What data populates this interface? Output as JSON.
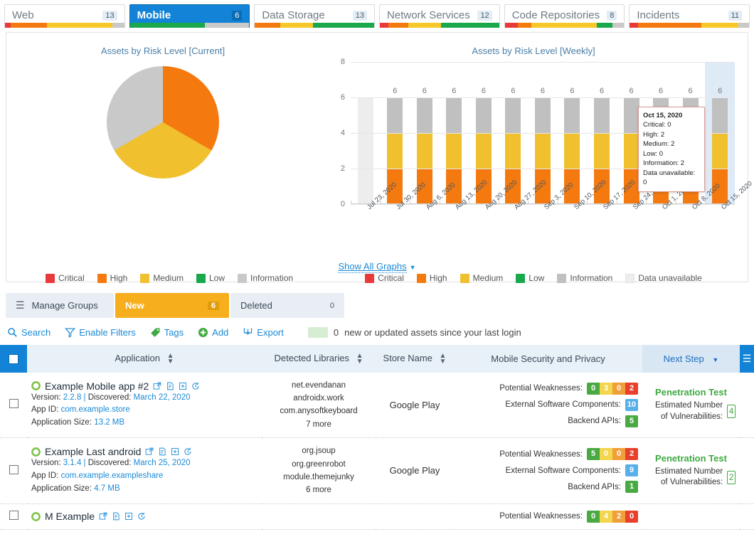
{
  "tabs": [
    {
      "label": "Web",
      "count": "13",
      "active": false,
      "bar": [
        {
          "color": "#e8393b",
          "w": 5
        },
        {
          "color": "#f47a10",
          "w": 30
        },
        {
          "color": "#f6c82a",
          "w": 55
        },
        {
          "color": "#c9c9c9",
          "w": 10
        }
      ]
    },
    {
      "label": "Mobile",
      "count": "6",
      "active": true,
      "bar": [
        {
          "color": "#1aa84c",
          "w": 63
        },
        {
          "color": "#c9c9c9",
          "w": 37
        }
      ]
    },
    {
      "label": "Data Storage",
      "count": "13",
      "active": false,
      "bar": [
        {
          "color": "#f47a10",
          "w": 21
        },
        {
          "color": "#f6c82a",
          "w": 28
        },
        {
          "color": "#1aa84c",
          "w": 51
        }
      ]
    },
    {
      "label": "Network Services",
      "count": "12",
      "active": false,
      "bar": [
        {
          "color": "#e8393b",
          "w": 7
        },
        {
          "color": "#f47a10",
          "w": 17
        },
        {
          "color": "#f6c82a",
          "w": 27
        },
        {
          "color": "#1aa84c",
          "w": 49
        }
      ]
    },
    {
      "label": "Code Repositories",
      "count": "8",
      "active": false,
      "bar": [
        {
          "color": "#e8393b",
          "w": 11
        },
        {
          "color": "#f47a10",
          "w": 11
        },
        {
          "color": "#f6c82a",
          "w": 55
        },
        {
          "color": "#1aa84c",
          "w": 13
        },
        {
          "color": "#c9c9c9",
          "w": 10
        }
      ]
    },
    {
      "label": "Incidents",
      "count": "11",
      "active": false,
      "bar": [
        {
          "color": "#e8393b",
          "w": 7
        },
        {
          "color": "#f47a10",
          "w": 53
        },
        {
          "color": "#f6c82a",
          "w": 31
        },
        {
          "color": "#c9c9c9",
          "w": 9
        }
      ]
    }
  ],
  "chart_data": [
    {
      "type": "pie",
      "title": "Assets by Risk Level [Current]",
      "categories": [
        "Critical",
        "High",
        "Medium",
        "Low",
        "Information"
      ],
      "values": [
        0,
        2,
        2,
        0,
        2
      ],
      "colors": [
        "#e8393b",
        "#f47a10",
        "#f0c02e",
        "#1aa84c",
        "#c9c9c9"
      ],
      "legend_position": "bottom"
    },
    {
      "type": "bar",
      "title": "Assets by Risk Level [Weekly]",
      "stacked": true,
      "grid": true,
      "ylim": [
        0,
        8
      ],
      "yticks": [
        "0",
        "2",
        "4",
        "6",
        "8"
      ],
      "legend_position": "bottom",
      "categories": [
        "Jul 23, 2020",
        "Jul 30, 2020",
        "Aug 6, 2020",
        "Aug 13, 2020",
        "Aug 20, 2020",
        "Aug 27, 2020",
        "Sep 3, 2020",
        "Sep 10, 2020",
        "Sep 17, 2020",
        "Sep 24, 2020",
        "Oct 1, 2020",
        "Oct 8, 2020",
        "Oct 15, 2020"
      ],
      "totals": [
        "",
        "6",
        "6",
        "6",
        "6",
        "6",
        "6",
        "6",
        "6",
        "6",
        "6",
        "6",
        "6"
      ],
      "series": [
        {
          "name": "Critical",
          "color": "#e8393b",
          "values": [
            0,
            0,
            0,
            0,
            0,
            0,
            0,
            0,
            0,
            0,
            0,
            0,
            0
          ]
        },
        {
          "name": "High",
          "color": "#f47a10",
          "values": [
            0,
            2,
            2,
            2,
            2,
            2,
            2,
            2,
            2,
            2,
            2,
            2,
            2
          ]
        },
        {
          "name": "Medium",
          "color": "#f0c02e",
          "values": [
            0,
            2,
            2,
            2,
            2,
            2,
            2,
            2,
            2,
            2,
            2,
            2,
            2
          ]
        },
        {
          "name": "Low",
          "color": "#1aa84c",
          "values": [
            0,
            0,
            0,
            0,
            0,
            0,
            0,
            0,
            0,
            0,
            0,
            0,
            0
          ]
        },
        {
          "name": "Information",
          "color": "#c0c0c0",
          "values": [
            0,
            2,
            2,
            2,
            2,
            2,
            2,
            2,
            2,
            2,
            2,
            2,
            2
          ]
        },
        {
          "name": "Data unavailable",
          "color": "#ededed",
          "values": [
            6,
            0,
            0,
            0,
            0,
            0,
            0,
            0,
            0,
            0,
            0,
            0,
            0
          ]
        }
      ],
      "highlight_category": "Oct 15, 2020"
    }
  ],
  "pie_legend": [
    {
      "label": "Critical",
      "color": "#e8393b"
    },
    {
      "label": "High",
      "color": "#f47a10"
    },
    {
      "label": "Medium",
      "color": "#f0c02e"
    },
    {
      "label": "Low",
      "color": "#1aa84c"
    },
    {
      "label": "Information",
      "color": "#c9c9c9"
    }
  ],
  "bar_legend": [
    {
      "label": "Critical",
      "color": "#e8393b"
    },
    {
      "label": "High",
      "color": "#f47a10"
    },
    {
      "label": "Medium",
      "color": "#f0c02e"
    },
    {
      "label": "Low",
      "color": "#1aa84c"
    },
    {
      "label": "Information",
      "color": "#c0c0c0"
    },
    {
      "label": "Data unavailable",
      "color": "#ededed"
    }
  ],
  "tooltip": {
    "date": "Oct 15, 2020",
    "lines": [
      "Critical: 0",
      "High: 2",
      "Medium: 2",
      "Low: 0",
      "Information: 2",
      "Data unavailable: 0"
    ]
  },
  "show_all_graphs": {
    "label": "Show All Graphs",
    "caret": "▼"
  },
  "groupbar": {
    "manage_label": "Manage Groups",
    "new_label": "New",
    "new_count": "6",
    "deleted_label": "Deleted",
    "deleted_count": "0"
  },
  "actionbar": {
    "search": "Search",
    "enable_filters": "Enable Filters",
    "tags": "Tags",
    "add": "Add",
    "export": "Export",
    "new_count": "0",
    "new_text": "new or updated assets since your last login"
  },
  "table": {
    "headers": {
      "application": "Application",
      "detected_libraries": "Detected Libraries",
      "store_name": "Store Name",
      "mobile_security": "Mobile Security and Privacy",
      "next_step": "Next Step"
    },
    "labels": {
      "version": "Version:",
      "discovered": "Discovered:",
      "app_id": "App ID:",
      "app_size": "Application Size:",
      "potential_weaknesses": "Potential Weaknesses:",
      "external_components": "External Software Components:",
      "backend_apis": "Backend APIs:",
      "estimated_vulns": "Estimated Number of Vulnerabilities:"
    },
    "rows": [
      {
        "name": "Example Mobile app #2",
        "version": "2.2.8",
        "discovered": "March 22, 2020",
        "app_id": "com.example.store",
        "app_size": "13.2 MB",
        "libraries": [
          "net.evendanan",
          "androidx.work",
          "com.anysoftkeyboard"
        ],
        "libraries_more": "7 more",
        "store": "Google Play",
        "weaknesses": [
          {
            "value": "0",
            "color": "#49a942"
          },
          {
            "value": "3",
            "color": "#f3d54e"
          },
          {
            "value": "0",
            "color": "#f0a03a"
          },
          {
            "value": "2",
            "color": "#e8402a"
          }
        ],
        "external_components": "10",
        "backend_apis": "5",
        "next_step": "Penetration Test",
        "estimated_vulns": "4"
      },
      {
        "name": "Example Last android",
        "version": "3.1.4",
        "discovered": "March 25, 2020",
        "app_id": "com.example.exampleshare",
        "app_size": "4.7 MB",
        "libraries": [
          "org.jsoup",
          "org.greenrobot",
          "module.themejunky"
        ],
        "libraries_more": "6 more",
        "store": "Google Play",
        "weaknesses": [
          {
            "value": "5",
            "color": "#49a942"
          },
          {
            "value": "0",
            "color": "#f3d54e"
          },
          {
            "value": "0",
            "color": "#f0a03a"
          },
          {
            "value": "2",
            "color": "#e8402a"
          }
        ],
        "external_components": "9",
        "backend_apis": "1",
        "next_step": "Penetration Test",
        "estimated_vulns": "2"
      },
      {
        "name": "M Example",
        "version": "",
        "discovered": "",
        "app_id": "",
        "app_size": "",
        "libraries": [],
        "libraries_more": "",
        "store": "",
        "weaknesses": [
          {
            "value": "0",
            "color": "#49a942"
          },
          {
            "value": "4",
            "color": "#f3d54e"
          },
          {
            "value": "2",
            "color": "#f0a03a"
          },
          {
            "value": "0",
            "color": "#e8402a"
          }
        ],
        "external_components": "",
        "backend_apis": "",
        "next_step": "",
        "estimated_vulns": ""
      }
    ]
  },
  "colors": {
    "accent": "#1283d6",
    "link": "#1b8ad6",
    "green": "#3faa41",
    "blue_chip": "#57b0ea"
  }
}
